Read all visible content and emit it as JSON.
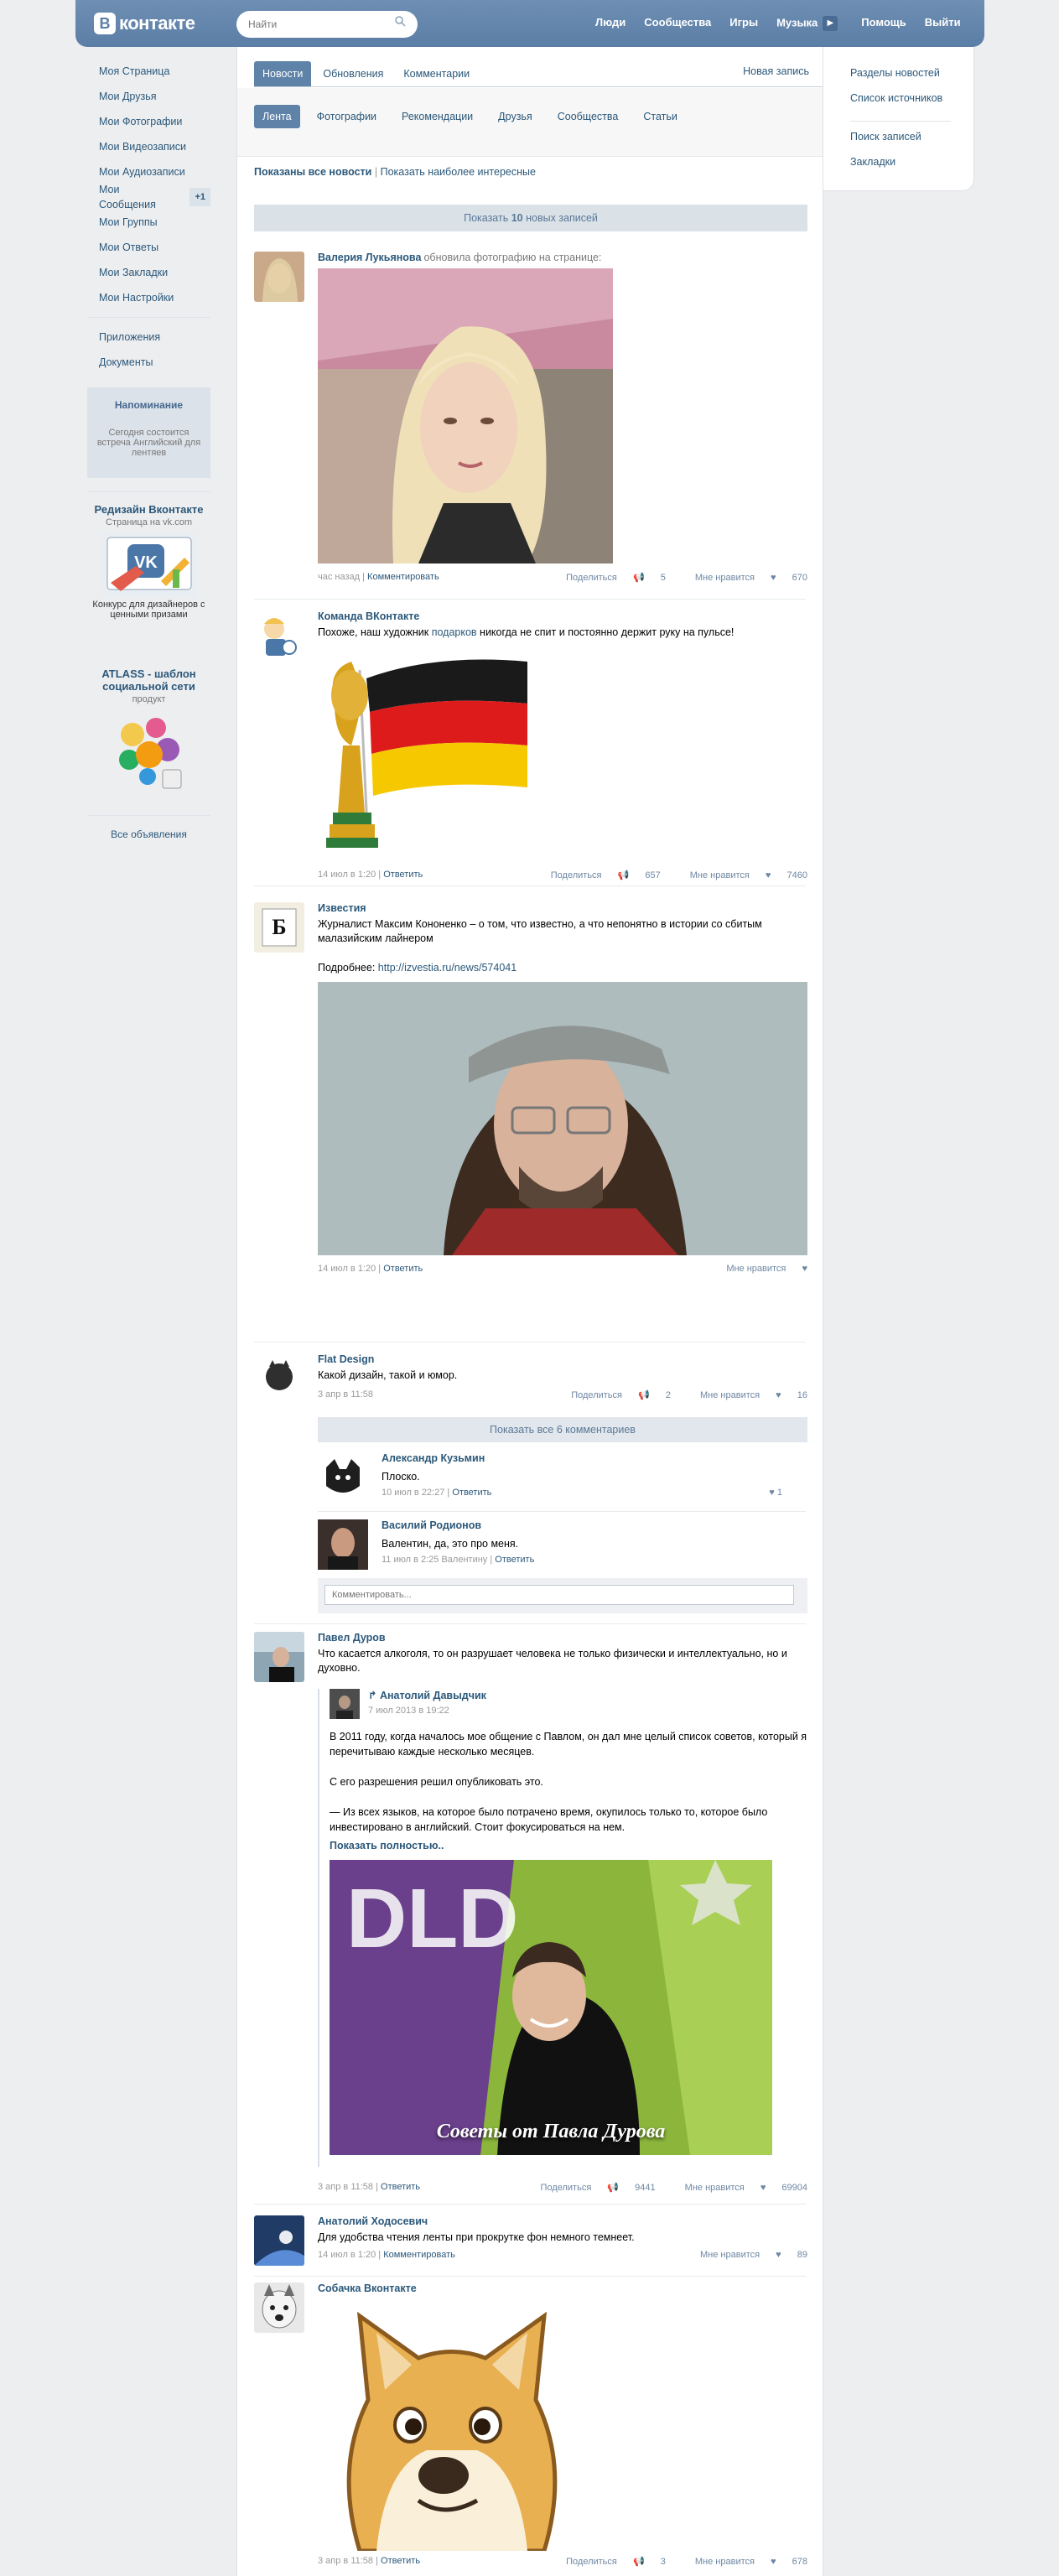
{
  "header": {
    "logo_text": "контакте",
    "logo_letter": "В",
    "search_placeholder": "Найти",
    "nav": [
      "Люди",
      "Сообщества",
      "Игры",
      "Музыка",
      "Помощь",
      "Выйти"
    ]
  },
  "sidebar": {
    "items": [
      {
        "label": "Моя Страница"
      },
      {
        "label": "Мои Друзья"
      },
      {
        "label": "Мои Фотографии"
      },
      {
        "label": "Мои Видеозаписи"
      },
      {
        "label": "Мои Аудиозаписи"
      },
      {
        "label": "Мои Сообщения",
        "badge": "+1"
      },
      {
        "label": "Мои Группы"
      },
      {
        "label": "Мои Ответы"
      },
      {
        "label": "Мои Закладки"
      },
      {
        "label": "Мои Настройки"
      }
    ],
    "extra": [
      {
        "label": "Приложения"
      },
      {
        "label": "Документы"
      }
    ],
    "reminder": {
      "title": "Напоминание",
      "text": "Сегодня состоится встреча Английский для лентяев"
    },
    "ads": [
      {
        "title": "Редизайн Вконтакте",
        "sub": "Страница на vk.com",
        "text": "Конкурс для дизайнеров с ценными призами"
      },
      {
        "title": "ATLASS - шаблон социальной сети",
        "sub": "продукт",
        "text": ""
      }
    ],
    "all_ads": "Все объявления"
  },
  "main": {
    "tabs": [
      "Новости",
      "Обновления",
      "Комментарии"
    ],
    "new_post": "Новая запись",
    "subtabs": [
      "Лента",
      "Фотографии",
      "Рекомендации",
      "Друзья",
      "Сообщества",
      "Статьи"
    ],
    "shown_all": "Показаны все новости",
    "shown_sep": "|",
    "shown_interesting": "Показать наиболее интересные",
    "show_new_prefix": "Показать",
    "show_new_count": "10",
    "show_new_suffix": "новых записей"
  },
  "posts": [
    {
      "author": "Валерия Лукьянова",
      "action": "обновила фотографию на странице:",
      "time": "час назад",
      "comment_link": "Комментировать",
      "share_label": "Поделиться",
      "shares": "5",
      "like_label": "Мне нравится",
      "likes": "670"
    },
    {
      "author": "Команда ВКонтакте",
      "text_a": "Похоже, наш художник ",
      "text_link": "подарков",
      "text_b": " никогда не спит и постоянно держит руку на пульсе!",
      "time": "14 июл в 1:20",
      "comment_link": "Ответить",
      "share_label": "Поделиться",
      "shares": "657",
      "like_label": "Мне нравится",
      "likes": "7460"
    },
    {
      "author": "Известия",
      "text": "Журналист Максим Кононенко – о том, что известно, а что непонятно в истории со сбитым малазийским лайнером",
      "more_label": "Подробнее:",
      "more_link": "http://izvestia.ru/news/574041",
      "time": "14 июл в 1:20",
      "comment_link": "Ответить",
      "like_label": "Мне нравится"
    },
    {
      "author": "Flat Design",
      "text": "Какой дизайн, такой и юмор.",
      "time": "3 апр в 11:58",
      "share_label": "Поделиться",
      "shares": "2",
      "like_label": "Мне нравится",
      "likes": "16",
      "show_comments": "Показать все 6 комментариев",
      "comments": [
        {
          "name": "Александр Кузьмин",
          "text": "Плоско.",
          "time": "10 июл в 22:27",
          "reply": "Ответить",
          "likes": "1"
        },
        {
          "name": "Василий Родионов",
          "text": "Валентин, да, это про меня.",
          "time": "11 июл в 2:25 Валентину",
          "reply": "Ответить"
        }
      ],
      "comment_placeholder": "Комментировать..."
    },
    {
      "author": "Павел Дуров",
      "text": "Что касается алкоголя, то он разрушает человека не только физически и интеллектуально, но и духовно.",
      "repost_author": "Анатолий Давыдчик",
      "repost_date": "7 июл 2013 в 19:22",
      "repost_p1": "В 2011 году, когда началось мое общение с Павлом, он дал мне целый список советов, который я перечитываю каждые несколько месяцев.",
      "repost_p2": "С его разрешения решил опубликовать это.",
      "repost_p3": "— Из всех языков, на которое было потрачено время, окупилось только то, которое было инвестировано в английский. Стоит фокусироваться на нем.",
      "show_full": "Показать полностью..",
      "image_caption": "Советы от Павла Дурова",
      "image_banner": "DLD",
      "time": "3 апр в 11:58",
      "comment_link": "Ответить",
      "share_label": "Поделиться",
      "shares": "9441",
      "like_label": "Мне нравится",
      "likes": "69904"
    },
    {
      "author": "Анатолий Ходосевич",
      "text": "Для удобства чтения ленты при прокрутке фон немного темнеет.",
      "time": "14 июл в 1:20",
      "comment_link": "Комментировать",
      "like_label": "Мне нравится",
      "likes": "89"
    },
    {
      "author": "Собачка Вконтакте",
      "time": "3 апр в 11:58",
      "comment_link": "Ответить",
      "share_label": "Поделиться",
      "shares": "3",
      "like_label": "Мне нравится",
      "likes": "678"
    }
  ],
  "right": {
    "items": [
      "Разделы новостей",
      "Список источников",
      "Поиск записей",
      "Закладки"
    ]
  }
}
